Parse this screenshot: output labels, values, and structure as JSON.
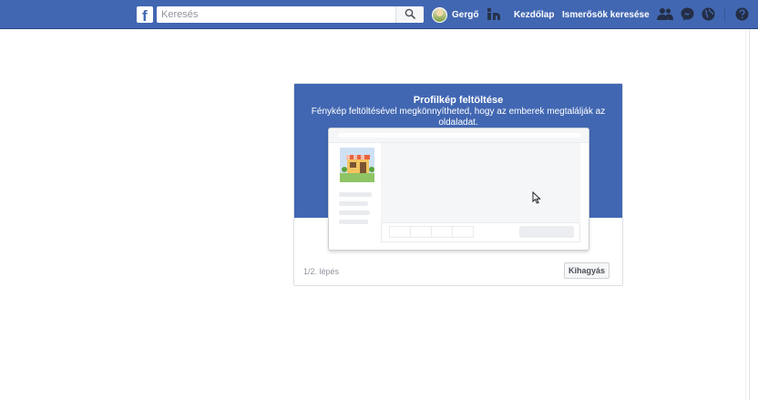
{
  "topbar": {
    "logo_letter": "f",
    "search": {
      "placeholder": "Keresés",
      "value": ""
    },
    "user": {
      "name": "Gergő"
    },
    "links": {
      "home": "Kezdőlap",
      "find_friends": "Ismerősök keresése"
    },
    "icons": [
      "facebook-logo-icon",
      "search-icon",
      "find-friends-icon",
      "friend-requests-icon",
      "messenger-icon",
      "notifications-globe-icon",
      "help-question-icon"
    ],
    "colors": {
      "brand": "#4267b2",
      "accent_border": "#29487d"
    }
  },
  "onboarding": {
    "title": "Profilkép feltöltése",
    "subtitle": "Fénykép feltöltésével megkönnyítheted, hogy az emberek megtalálják az oldaladat.",
    "step": "1/2. lépés",
    "skip_label": "Kihagyás"
  }
}
